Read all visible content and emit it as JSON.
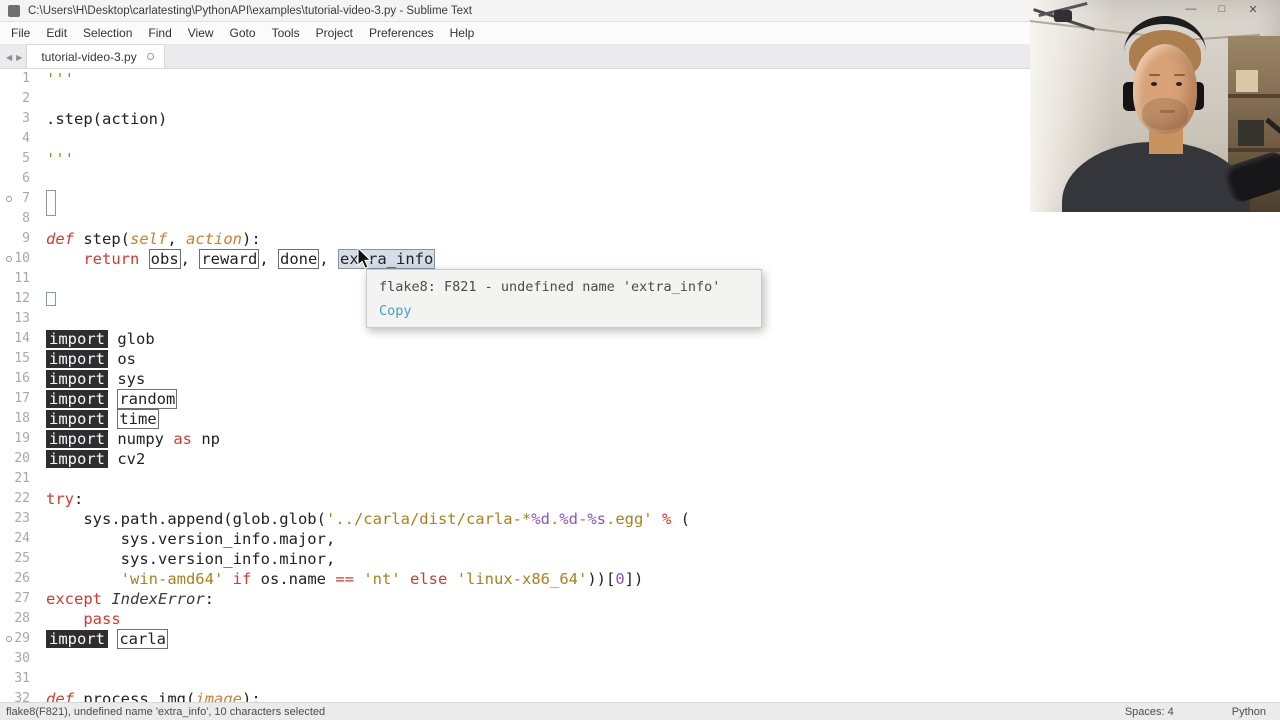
{
  "window": {
    "title": "C:\\Users\\H\\Desktop\\carlatesting\\PythonAPI\\examples\\tutorial-video-3.py - Sublime Text",
    "minimize": "—",
    "maximize": "□",
    "close": "✕"
  },
  "menu": {
    "items": [
      "File",
      "Edit",
      "Selection",
      "Find",
      "View",
      "Goto",
      "Tools",
      "Project",
      "Preferences",
      "Help"
    ]
  },
  "tab_bar": {
    "scroll_left": "◀",
    "scroll_right": "▶",
    "active_tab": "tutorial-video-3.py",
    "modified": true
  },
  "editor": {
    "selection": "extra_info",
    "lines": [
      {
        "n": 1,
        "tokens": [
          [
            "'''",
            "str"
          ]
        ]
      },
      {
        "n": 2,
        "tokens": []
      },
      {
        "n": 3,
        "tokens": [
          [
            ".step(action)",
            "p"
          ]
        ]
      },
      {
        "n": 4,
        "tokens": []
      },
      {
        "n": 5,
        "tokens": [
          [
            "'''",
            "str"
          ]
        ]
      },
      {
        "n": 6,
        "tokens": []
      },
      {
        "n": 7,
        "tokens": [
          [
            "",
            "wsboxtall"
          ]
        ],
        "mark": true
      },
      {
        "n": 8,
        "tokens": []
      },
      {
        "n": 9,
        "tokens": [
          [
            "def ",
            "kwi"
          ],
          [
            "step",
            "p"
          ],
          [
            "(",
            "p"
          ],
          [
            "self",
            "param"
          ],
          [
            ", ",
            "p"
          ],
          [
            "action",
            "param"
          ],
          [
            "):",
            "p"
          ]
        ]
      },
      {
        "n": 10,
        "tokens": [
          [
            "    ",
            "p"
          ],
          [
            "return",
            "kw"
          ],
          [
            " ",
            "p"
          ],
          [
            "obs",
            "outl"
          ],
          [
            ", ",
            "p"
          ],
          [
            "reward",
            "outl"
          ],
          [
            ", ",
            "p"
          ],
          [
            "done",
            "outl"
          ],
          [
            ", ",
            "p"
          ],
          [
            "extra_info",
            "sel"
          ]
        ],
        "mark": true
      },
      {
        "n": 11,
        "tokens": []
      },
      {
        "n": 12,
        "tokens": [
          [
            "",
            "wsbox"
          ]
        ]
      },
      {
        "n": 13,
        "tokens": []
      },
      {
        "n": 14,
        "tokens": [
          [
            "import",
            "imp"
          ],
          [
            " glob",
            "p"
          ]
        ]
      },
      {
        "n": 15,
        "tokens": [
          [
            "import",
            "imp"
          ],
          [
            " os",
            "p"
          ]
        ]
      },
      {
        "n": 16,
        "tokens": [
          [
            "import",
            "imp"
          ],
          [
            " sys",
            "p"
          ]
        ]
      },
      {
        "n": 17,
        "tokens": [
          [
            "import",
            "imp"
          ],
          [
            " ",
            "p"
          ],
          [
            "random",
            "outl"
          ]
        ]
      },
      {
        "n": 18,
        "tokens": [
          [
            "import",
            "imp"
          ],
          [
            " ",
            "p"
          ],
          [
            "time",
            "outl"
          ]
        ]
      },
      {
        "n": 19,
        "tokens": [
          [
            "import",
            "imp"
          ],
          [
            " numpy ",
            "p"
          ],
          [
            "as",
            "kw"
          ],
          [
            " np",
            "p"
          ]
        ]
      },
      {
        "n": 20,
        "tokens": [
          [
            "import",
            "imp"
          ],
          [
            " cv2",
            "p"
          ]
        ]
      },
      {
        "n": 21,
        "tokens": []
      },
      {
        "n": 22,
        "tokens": [
          [
            "try",
            "kw"
          ],
          [
            ":",
            "p"
          ]
        ]
      },
      {
        "n": 23,
        "tokens": [
          [
            "    sys.path.append(glob.glob(",
            "p"
          ],
          [
            "'../carla/dist/carla-*",
            "str"
          ],
          [
            "%d",
            "esc"
          ],
          [
            ".",
            "str"
          ],
          [
            "%d",
            "esc"
          ],
          [
            "-",
            "str"
          ],
          [
            "%s",
            "esc"
          ],
          [
            ".egg'",
            "str"
          ],
          [
            " ",
            "p"
          ],
          [
            "%",
            "kw"
          ],
          [
            " (",
            "p"
          ]
        ]
      },
      {
        "n": 24,
        "tokens": [
          [
            "        sys.version_info.major,",
            "p"
          ]
        ]
      },
      {
        "n": 25,
        "tokens": [
          [
            "        sys.version_info.minor,",
            "p"
          ]
        ]
      },
      {
        "n": 26,
        "tokens": [
          [
            "        ",
            "p"
          ],
          [
            "'win-amd64'",
            "str"
          ],
          [
            " ",
            "p"
          ],
          [
            "if",
            "kw"
          ],
          [
            " os.name ",
            "p"
          ],
          [
            "==",
            "kw"
          ],
          [
            " ",
            "p"
          ],
          [
            "'nt'",
            "str"
          ],
          [
            " ",
            "p"
          ],
          [
            "else",
            "kw"
          ],
          [
            " ",
            "p"
          ],
          [
            "'linux-x86_64'",
            "str"
          ],
          [
            "))[",
            "p"
          ],
          [
            "0",
            "num"
          ],
          [
            "])",
            "p"
          ]
        ]
      },
      {
        "n": 27,
        "tokens": [
          [
            "except",
            "kw"
          ],
          [
            " ",
            "p"
          ],
          [
            "IndexError",
            "cls"
          ],
          [
            ":",
            "p"
          ]
        ]
      },
      {
        "n": 28,
        "tokens": [
          [
            "    ",
            "p"
          ],
          [
            "pass",
            "kw"
          ]
        ]
      },
      {
        "n": 29,
        "tokens": [
          [
            "import",
            "imp"
          ],
          [
            " ",
            "p"
          ],
          [
            "carla",
            "outl"
          ]
        ],
        "mark": true
      },
      {
        "n": 30,
        "tokens": []
      },
      {
        "n": 31,
        "tokens": []
      },
      {
        "n": 32,
        "tokens": [
          [
            "def ",
            "kwi"
          ],
          [
            "process_img",
            "p"
          ],
          [
            "(",
            "p"
          ],
          [
            "image",
            "param"
          ],
          [
            "):",
            "p"
          ]
        ]
      }
    ]
  },
  "lint_tooltip": {
    "message": "flake8: F821 - undefined name 'extra_info'",
    "copy_label": "Copy"
  },
  "status_bar": {
    "left": "flake8(F821), undefined name 'extra_info', 10 characters selected",
    "indent": "Spaces: 4",
    "syntax": "Python"
  }
}
